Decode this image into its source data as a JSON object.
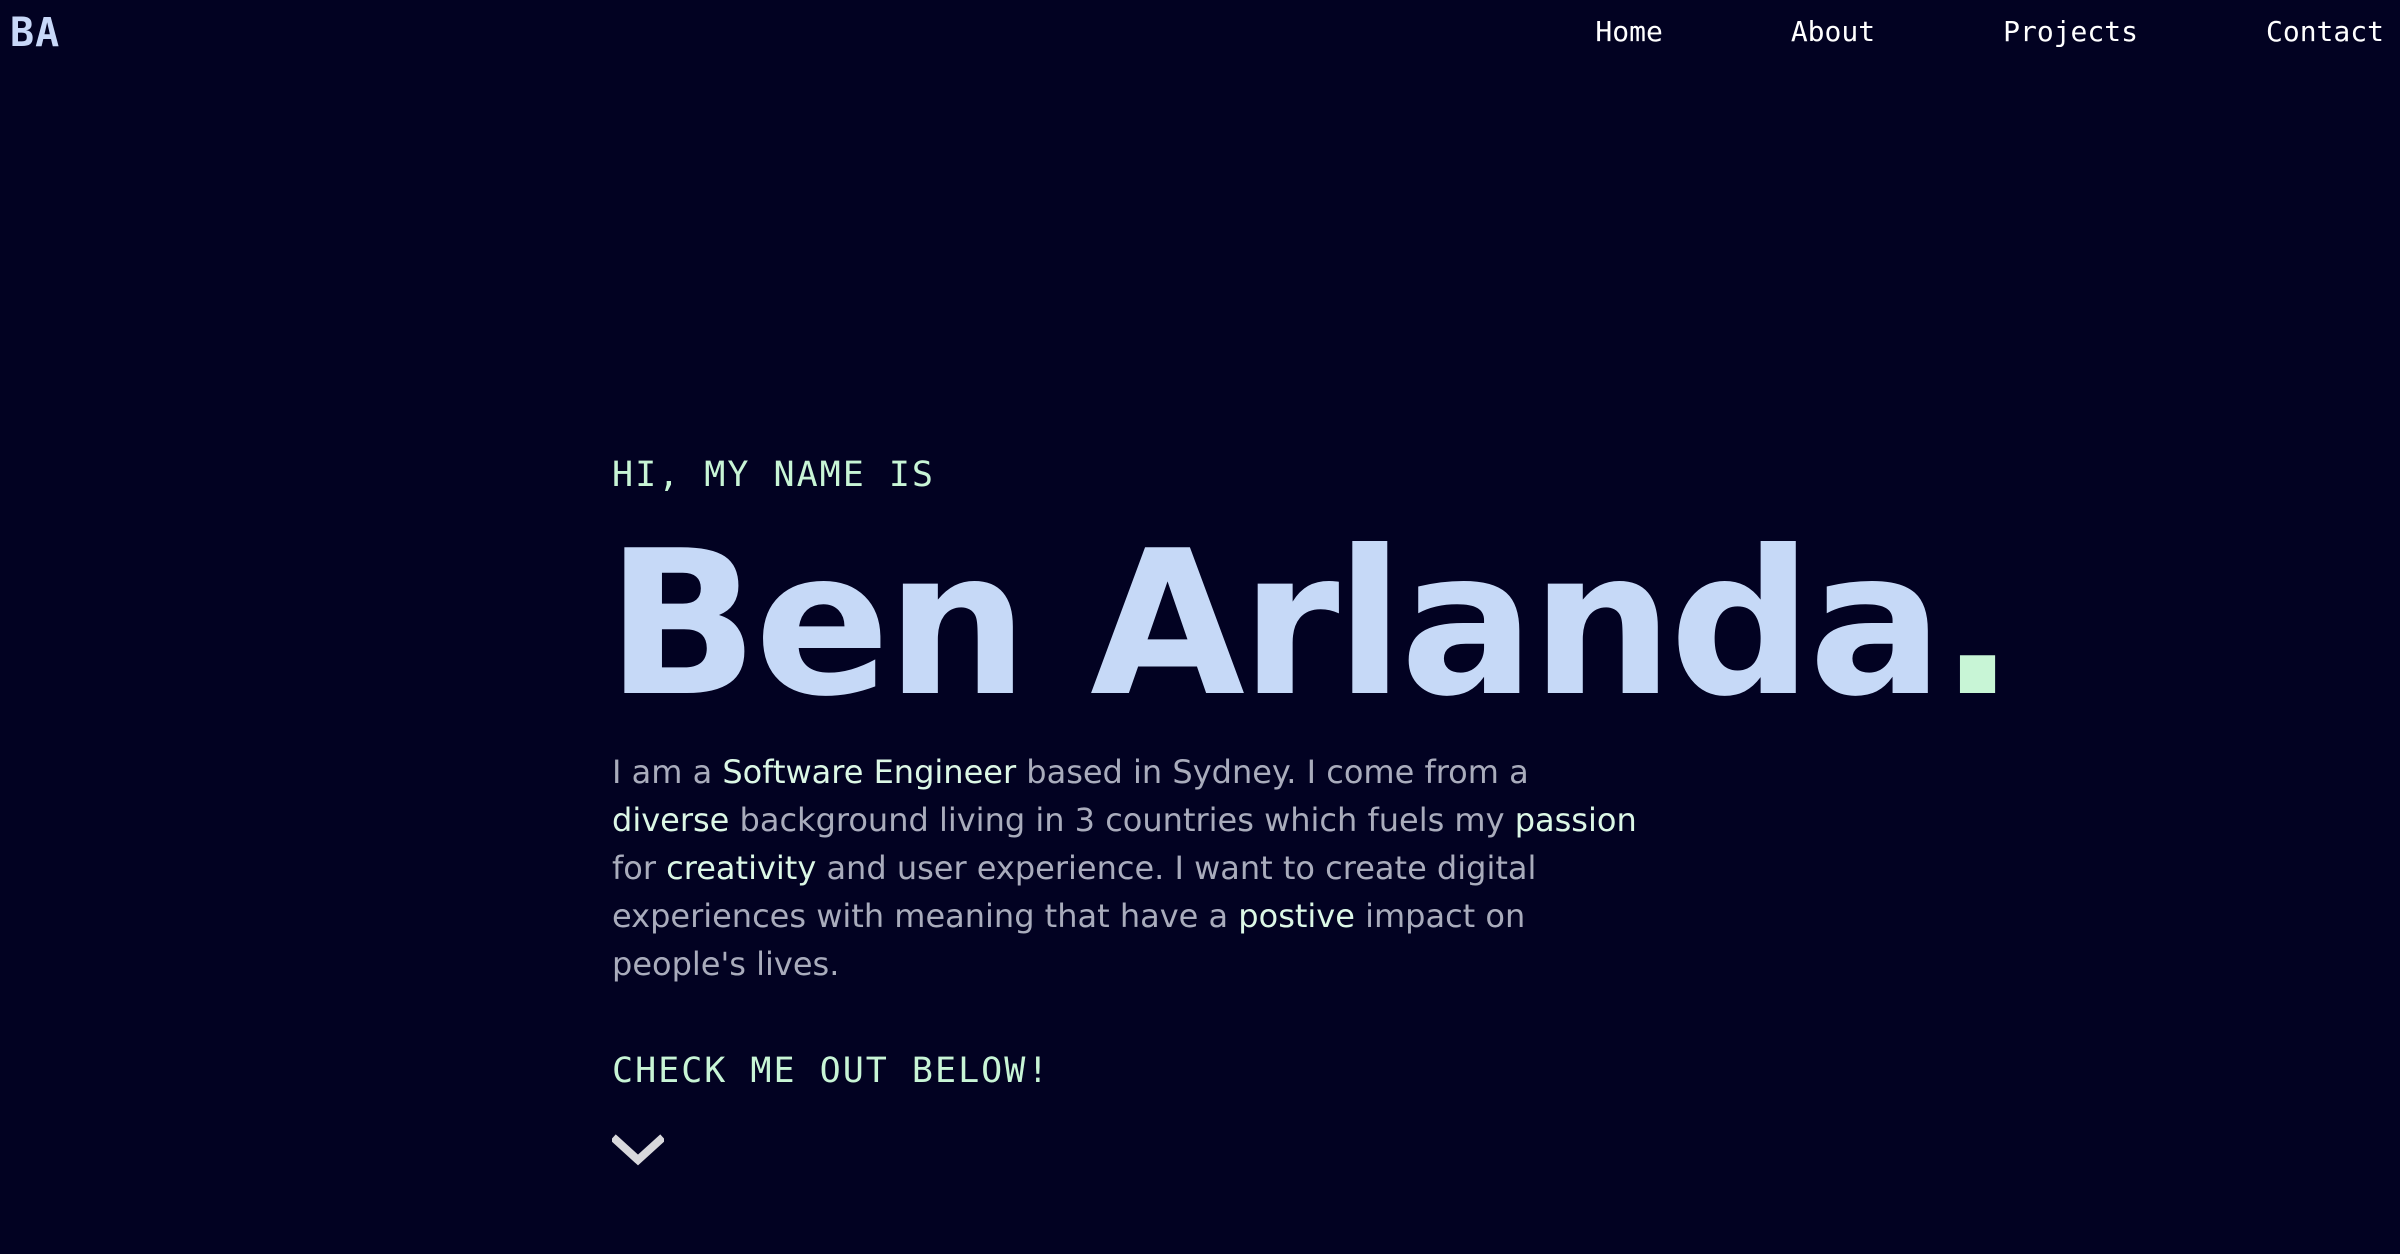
{
  "header": {
    "logo": "BA",
    "nav": [
      "Home",
      "About",
      "Projects",
      "Contact"
    ]
  },
  "hero": {
    "greeting": "HI, MY NAME IS",
    "name": "Ben Arlanda",
    "name_dot": ".",
    "bio": [
      {
        "text": "I am a ",
        "highlight": false
      },
      {
        "text": "Software Engineer",
        "highlight": true
      },
      {
        "text": " based in Sydney. I come from a ",
        "highlight": false
      },
      {
        "text": "diverse",
        "highlight": true
      },
      {
        "text": " background living in 3 countries which fuels my ",
        "highlight": false
      },
      {
        "text": "passion",
        "highlight": true
      },
      {
        "text": " for ",
        "highlight": false
      },
      {
        "text": "creativity",
        "highlight": true
      },
      {
        "text": " and user experience. I want to create digital experiences with meaning that have a ",
        "highlight": false
      },
      {
        "text": "postive",
        "highlight": true
      },
      {
        "text": " impact on people's lives.",
        "highlight": false
      }
    ],
    "cta": "CHECK ME OUT BELOW!",
    "scroll_icon": "chevron-down-icon"
  },
  "colors": {
    "background": "#020222",
    "accent": "#c8f5d6",
    "name": "#c6d9f7",
    "body_text": "#a9acbc"
  }
}
